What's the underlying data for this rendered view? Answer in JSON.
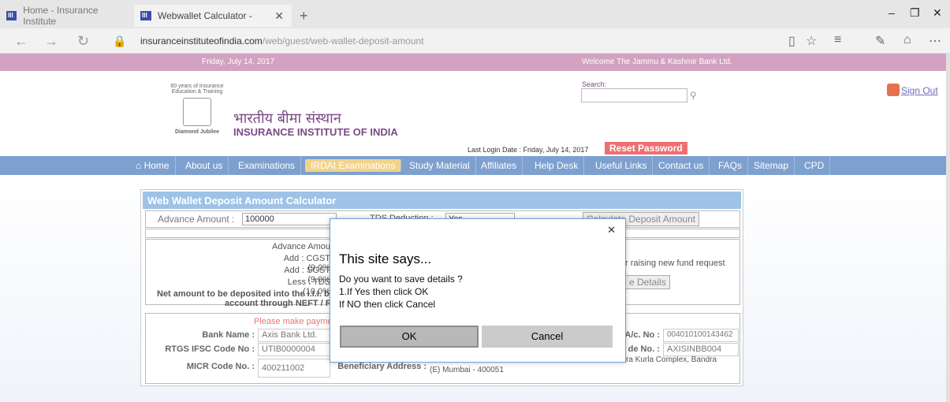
{
  "browser": {
    "tabs": [
      {
        "label": "Home - Insurance Institute"
      },
      {
        "label": "Webwallet Calculator - "
      }
    ],
    "url_host": "insuranceinstituteofindia.com",
    "url_path": "/web/guest/web-wallet-deposit-amount"
  },
  "topstrip": {
    "date": "Friday, July 14, 2017",
    "welcome": "Welcome The Jammu & Kashmir Bank Ltd."
  },
  "header": {
    "seal_text": "60 years of Insurance Education & Training",
    "seal_bottom": "Diamond Jubilee",
    "hindi_name": "भारतीय बीमा संस्थान",
    "english_name": "INSURANCE INSTITUTE OF INDIA",
    "search_label": "Search:",
    "signout": "Sign Out",
    "last_login": "Last Login Date : Friday, July 14, 2017",
    "reset_password": "Reset Password"
  },
  "nav": [
    {
      "label": "Home"
    },
    {
      "label": "About us"
    },
    {
      "label": "Examinations"
    },
    {
      "label": "IRDAI Examinations"
    },
    {
      "label": "Study Material"
    },
    {
      "label": "Affiliates"
    },
    {
      "label": "Help Desk"
    },
    {
      "label": "Useful Links"
    },
    {
      "label": "Contact us"
    },
    {
      "label": "FAQs"
    },
    {
      "label": "Sitemap"
    },
    {
      "label": "CPD"
    }
  ],
  "calculator": {
    "title": "Web Wallet Deposit Amount Calculator",
    "advance_label": "Advance Amount :",
    "advance_value": "100000",
    "tds_label": "TDS Deduction :",
    "tds_value": "Yes",
    "calc_button": "Calculate Deposit Amount",
    "rows": [
      "Advance Amou",
      "Add : CGST (9.0%",
      "Add : SGST (9.0%",
      "Less : TDS (10.0%"
    ],
    "net_line1": "Net amount to be deposited into the I.I.I. ba",
    "net_line2": "account through NEFT / RTG",
    "note": "r raising new fund request",
    "save_button": "e Details",
    "payment_note": "Please make paymen",
    "bank_name_label": "Bank Name :",
    "bank_name": "Axis Bank Ltd.",
    "rtgs_label": "RTGS IFSC Code No :",
    "rtgs_value": "UTIB0000004",
    "micr_label": "MICR Code No. :",
    "micr_value": "400211002",
    "ac_label": "A/c. No :",
    "ac_value": "004010100143462",
    "code_label": "de No. :",
    "code_value": "AXISINBB004",
    "beneficiary_label": "Beneficiary Address :",
    "beneficiary_line1": "Plot No. C-29, G Block, Near American Consulate, Bandra Kurla Complex, Bandra",
    "beneficiary_line2": "(E) Mumbai - 400051"
  },
  "dialog": {
    "title": "This site says...",
    "line1": "Do you want to save details ?",
    "line2": "1.If Yes then click OK",
    "line3": "If NO then click Cancel",
    "ok": "OK",
    "cancel": "Cancel"
  }
}
